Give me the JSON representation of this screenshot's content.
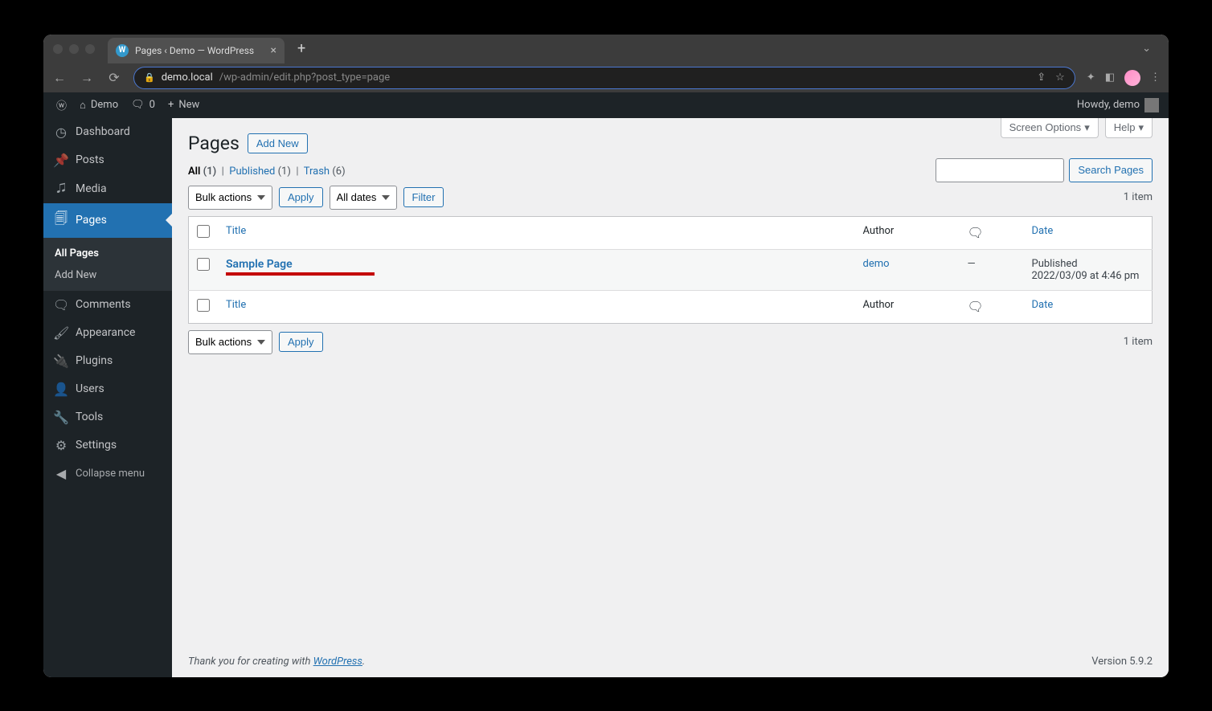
{
  "browser": {
    "tab_title": "Pages ‹ Demo — WordPress",
    "url_host": "demo.local",
    "url_path": "/wp-admin/edit.php?post_type=page"
  },
  "adminbar": {
    "site_name": "Demo",
    "comments_count": "0",
    "new_label": "New",
    "howdy": "Howdy, demo"
  },
  "sidebar": {
    "items": [
      {
        "icon": "◉",
        "label": "Dashboard"
      },
      {
        "icon": "📌",
        "label": "Posts"
      },
      {
        "icon": "🎵",
        "label": "Media"
      },
      {
        "icon": "📄",
        "label": "Pages",
        "current": true
      },
      {
        "icon": "💬",
        "label": "Comments"
      },
      {
        "icon": "🖌",
        "label": "Appearance"
      },
      {
        "icon": "🔌",
        "label": "Plugins"
      },
      {
        "icon": "👤",
        "label": "Users"
      },
      {
        "icon": "🔧",
        "label": "Tools"
      },
      {
        "icon": "⚙",
        "label": "Settings"
      }
    ],
    "submenu": [
      {
        "label": "All Pages",
        "current": true
      },
      {
        "label": "Add New"
      }
    ],
    "collapse_label": "Collapse menu"
  },
  "screen_meta": {
    "screen_options": "Screen Options",
    "help": "Help"
  },
  "page": {
    "title": "Pages",
    "add_new": "Add New"
  },
  "filters": {
    "all_label": "All",
    "all_count": "(1)",
    "published_label": "Published",
    "published_count": "(1)",
    "trash_label": "Trash",
    "trash_count": "(6)",
    "bulk_actions": "Bulk actions",
    "apply": "Apply",
    "all_dates": "All dates",
    "filter": "Filter",
    "item_count": "1 item",
    "search_button": "Search Pages"
  },
  "table": {
    "cols": {
      "title": "Title",
      "author": "Author",
      "date": "Date"
    },
    "rows": [
      {
        "title": "Sample Page",
        "author": "demo",
        "comments": "—",
        "status": "Published",
        "date": "2022/03/09 at 4:46 pm"
      }
    ]
  },
  "footer": {
    "thanks": "Thank you for creating with ",
    "wp_link": "WordPress",
    "period": ".",
    "version": "Version 5.9.2"
  }
}
